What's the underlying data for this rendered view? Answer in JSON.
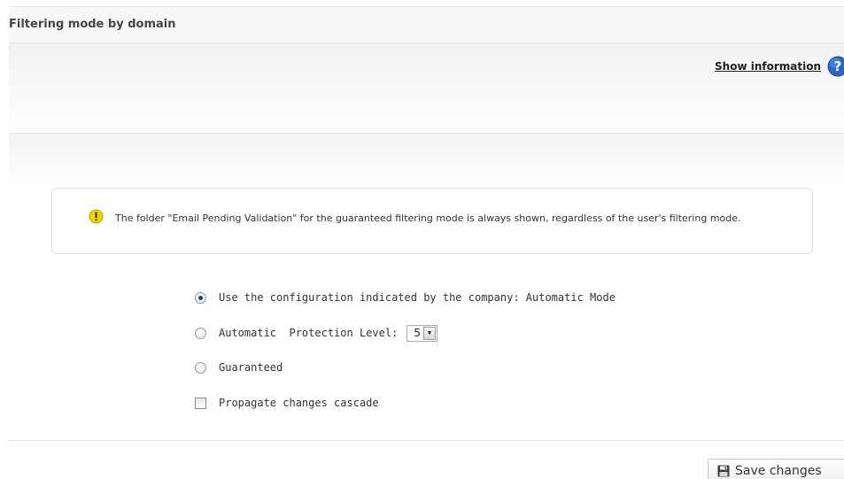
{
  "section": {
    "title": "Filtering mode by domain"
  },
  "info": {
    "show_information_label": "Show information",
    "help_icon": "help-question-icon"
  },
  "notice": {
    "icon": "warning-exclamation-icon",
    "text": "The folder \"Email Pending Validation\" for the guaranteed filtering mode is always shown, regardless of the user's filtering mode."
  },
  "options": {
    "company_config": {
      "label": "Use the configuration indicated by the company: Automatic Mode",
      "selected": true
    },
    "automatic": {
      "label": "Automatic  Protection Level:",
      "selected": false,
      "level_value": "5"
    },
    "guaranteed": {
      "label": "Guaranteed",
      "selected": false
    },
    "propagate": {
      "label": "Propagate changes cascade",
      "checked": false
    }
  },
  "actions": {
    "save_label": "Save changes",
    "save_icon": "floppy-disk-icon"
  },
  "colors": {
    "help_icon_blue": "#2a66c9",
    "warning_yellow": "#e8d800",
    "radio_selected": "#1f3f73"
  }
}
